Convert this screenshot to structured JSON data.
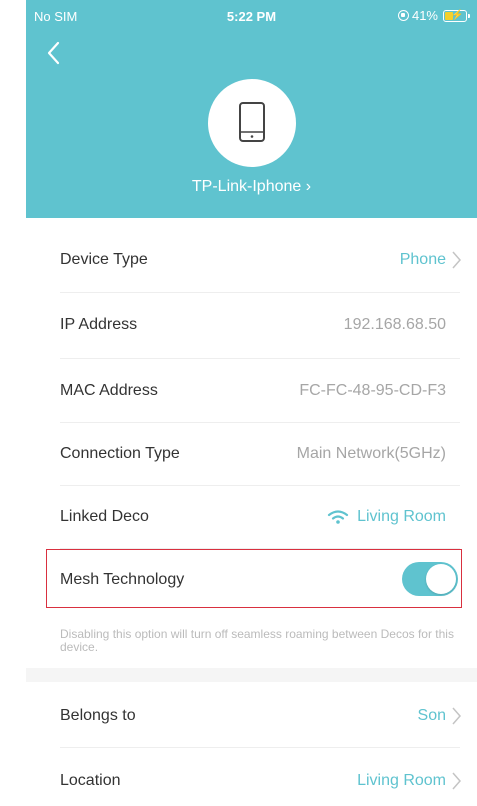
{
  "status_bar": {
    "carrier": "No SIM",
    "time": "5:22 PM",
    "battery_percent": "41%",
    "battery_level": 0.41,
    "icons": [
      "orientation-lock-icon",
      "battery-charging-icon"
    ]
  },
  "header": {
    "back_icon": "chevron-left-icon",
    "device_icon": "smartphone-icon",
    "device_name": "TP-Link-Iphone ›",
    "background_color": "#5fc3cf"
  },
  "details": {
    "device_type": {
      "label": "Device Type",
      "value": "Phone"
    },
    "ip_address": {
      "label": "IP Address",
      "value": "192.168.68.50"
    },
    "mac_address": {
      "label": "MAC Address",
      "value": "FC-FC-48-95-CD-F3"
    },
    "connection_type": {
      "label": "Connection Type",
      "value": "Main Network(5GHz)"
    },
    "linked_deco": {
      "label": "Linked Deco",
      "value": "Living Room",
      "icon": "wifi-icon"
    },
    "mesh_technology": {
      "label": "Mesh Technology",
      "enabled": true
    },
    "mesh_hint": "Disabling this option will turn off seamless roaming between Decos for this device."
  },
  "assignment": {
    "belongs_to": {
      "label": "Belongs to",
      "value": "Son"
    },
    "location": {
      "label": "Location",
      "value": "Living Room"
    }
  },
  "colors": {
    "accent": "#5fc3cf",
    "highlight_border": "#d9303f",
    "label_text": "#333333",
    "value_text": "#a6a6a6"
  }
}
